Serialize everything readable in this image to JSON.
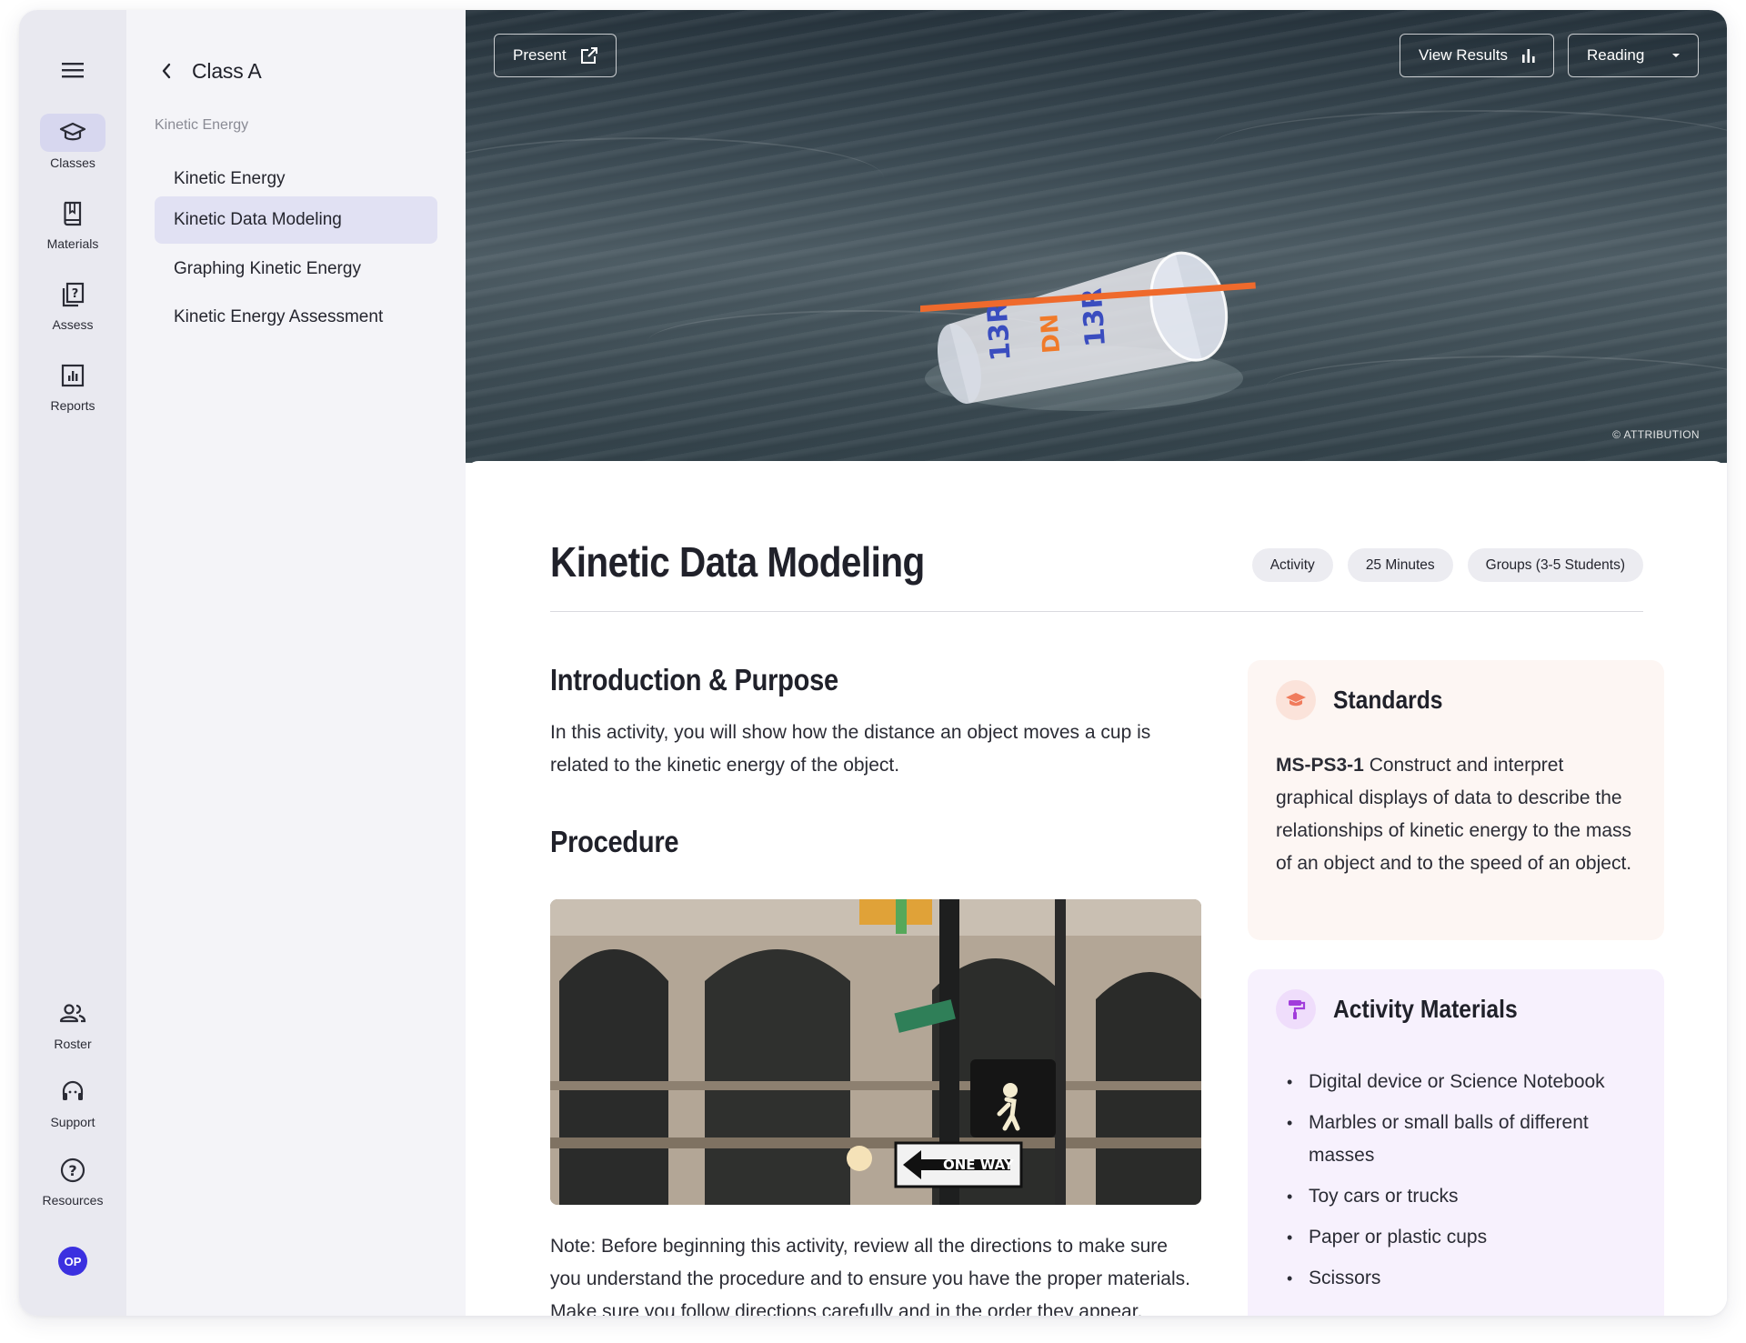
{
  "rail": {
    "items": [
      {
        "label": "Classes",
        "icon": "graduation-cap-icon",
        "active": true
      },
      {
        "label": "Materials",
        "icon": "book-icon",
        "active": false
      },
      {
        "label": "Assess",
        "icon": "quiz-icon",
        "active": false
      },
      {
        "label": "Reports",
        "icon": "report-chart-icon",
        "active": false
      }
    ],
    "bottom_items": [
      {
        "label": "Roster",
        "icon": "people-icon"
      },
      {
        "label": "Support",
        "icon": "headset-icon"
      },
      {
        "label": "Resources",
        "icon": "help-circle-icon"
      }
    ],
    "avatar_initials": "OP",
    "avatar_color": "#3b30e0"
  },
  "subnav": {
    "title": "Class A",
    "section_label": "Kinetic Energy",
    "items": [
      {
        "label": "Kinetic Energy",
        "active": false
      },
      {
        "label": "Kinetic Data Modeling",
        "active": true
      },
      {
        "label": "Graphing Kinetic Energy",
        "active": false
      },
      {
        "label": "Kinetic Energy Assessment",
        "active": false
      }
    ]
  },
  "hero": {
    "present_label": "Present",
    "view_results_label": "View Results",
    "reading_label": "Reading",
    "attribution": "© ATTRIBUTION"
  },
  "page": {
    "title": "Kinetic Data Modeling",
    "chips": [
      "Activity",
      "25 Minutes",
      "Groups (3-5 Students)"
    ],
    "intro_heading": "Introduction & Purpose",
    "intro_text": "In this activity, you will show how the distance an object moves a cup is related to the kinetic energy of the object.",
    "procedure_heading": "Procedure",
    "note_text": "Note: Before beginning this activity, review all the directions to make sure you understand the procedure and to ensure you have the proper materials. Make sure you follow directions carefully and in the order they appear."
  },
  "standards": {
    "heading": "Standards",
    "code": "MS-PS3-1",
    "text": " Construct and interpret graphical displays of data to describe the relationships of kinetic energy to the mass of an object and to the speed of an object.",
    "accent": "#f07b5c"
  },
  "materials": {
    "heading": "Activity Materials",
    "items": [
      "Digital device or Science Notebook",
      "Marbles or small balls of different masses",
      "Toy cars or trucks",
      "Paper or plastic cups",
      "Scissors"
    ],
    "accent": "#a13ddb"
  },
  "colors": {
    "rail_bg": "#e9e9f0",
    "subnav_bg": "#f4f4f8",
    "active_item_bg": "#e1e1f3"
  }
}
